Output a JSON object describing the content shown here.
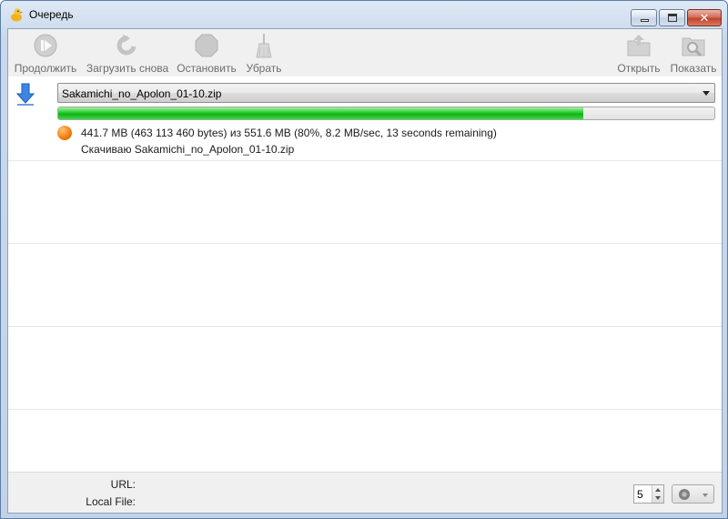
{
  "window": {
    "title": "Очередь",
    "controls": [
      "minimize",
      "maximize",
      "close"
    ],
    "close_glyph": "✕"
  },
  "toolbar": {
    "buttons": [
      {
        "label": "Продолжить",
        "icon": "resume-icon",
        "enabled": false
      },
      {
        "label": "Загрузить снова",
        "icon": "redownload-icon",
        "enabled": false
      },
      {
        "label": "Остановить",
        "icon": "stop-icon",
        "enabled": false
      },
      {
        "label": "Убрать",
        "icon": "broom-icon",
        "enabled": false
      },
      {
        "label": "Открыть",
        "icon": "open-folder-icon",
        "enabled": false
      },
      {
        "label": "Показать",
        "icon": "show-in-folder-icon",
        "enabled": false
      }
    ]
  },
  "download": {
    "file": "Sakamichi_no_Apolon_01-10.zip",
    "progress_fraction": 0.8,
    "status": "441.7 MB (463 113 460 bytes) из 551.6 MB (80%, 8.2 MB/sec, 13 seconds remaining)",
    "action": "Скачиваю Sakamichi_no_Apolon_01-10.zip",
    "status_color": "#f07c0c"
  },
  "details": {
    "url_label": "URL:",
    "url_value": "",
    "local_file_label": "Local File:",
    "local_file_value": ""
  },
  "controls": {
    "concurrent": "5",
    "speed_icon": "speed-dial-icon"
  },
  "colors": {
    "progress": "#1cc222",
    "accent": "#3a7bd5"
  }
}
